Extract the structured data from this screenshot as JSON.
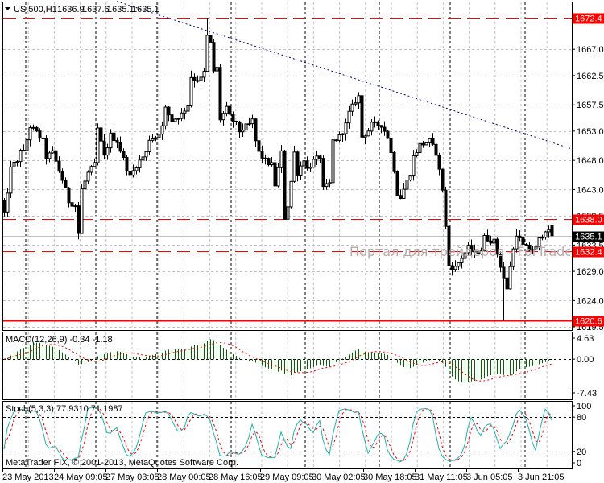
{
  "header": {
    "menu_icon": "triangle-down-icon",
    "symbol": "US.500,H1",
    "open": "1636.9",
    "high": "1637.6",
    "low": "1635.1",
    "close": "1635.1"
  },
  "watermark": "Портал для трейдеров - ForTrader",
  "copyright": "MetaTrader FIX, © 2001-2013, MetaQuotes Software Corp.",
  "price_axis": {
    "labels": [
      "1667.0",
      "1662.5",
      "1657.5",
      "1653.0",
      "1648.0",
      "1643.0",
      "1638.5",
      "1633.5",
      "1629.0",
      "1624.0",
      "1619.5"
    ],
    "range": [
      1619.5,
      1672.4
    ]
  },
  "levels": [
    {
      "price": "1672.4",
      "style": "dashed",
      "color": "#ff0000"
    },
    {
      "price": "1638.0",
      "style": "dashed",
      "color": "#ff0000"
    },
    {
      "price": "1632.4",
      "style": "dashed",
      "color": "#ff0000"
    },
    {
      "price": "1620.6",
      "style": "solid",
      "color": "#ff0000"
    }
  ],
  "current_price": {
    "price": "1635.1",
    "color": "#000000"
  },
  "trendline": {
    "color": "#000080",
    "from": {
      "bar": 35,
      "price": 1675.2
    },
    "to": {
      "bar": 176,
      "price": 1650.0
    }
  },
  "time_axis": [
    "23 May 2013",
    "24 May 09:05",
    "27 May 03:05",
    "28 May 00:05",
    "28 May 16:05",
    "29 May 09:05",
    "30 May 02:05",
    "30 May 18:05",
    "31 May 11:05",
    "3 Jun 05:05",
    "3 Jun 21:05"
  ],
  "macd": {
    "label": "MACD(12,26,9) -0.34 -1.18",
    "axis_labels": [
      "4.63",
      "0.00",
      "-7.43"
    ],
    "range": [
      -7.43,
      4.63
    ],
    "hist_color": "#006400",
    "signal_color": "#ff0000"
  },
  "stoch": {
    "label": "Stoch(5,3,3) 77.9310 71.1987",
    "axis_labels": [
      "100",
      "80",
      "20",
      "0"
    ],
    "main_color": "#20b2aa",
    "signal_color": "#ff0000"
  },
  "chart_data": {
    "type": "candlestick",
    "title": "US.500,H1",
    "ylim": [
      1619.5,
      1672.4
    ],
    "bars": 171,
    "close_path": [
      [
        0,
        1639
      ],
      [
        1,
        1641.9
      ],
      [
        2,
        1647.2
      ],
      [
        4,
        1647.5
      ],
      [
        5,
        1650
      ],
      [
        6,
        1649.3
      ],
      [
        8,
        1653.8
      ],
      [
        10,
        1652.7
      ],
      [
        12,
        1651.3
      ],
      [
        13,
        1648.6
      ],
      [
        15,
        1649.3
      ],
      [
        18,
        1644.7
      ],
      [
        20,
        1641
      ],
      [
        22,
        1640.3
      ],
      [
        23,
        1635.5
      ],
      [
        24,
        1643
      ],
      [
        26,
        1645.8
      ],
      [
        28,
        1647.2
      ],
      [
        29,
        1653.4
      ],
      [
        31,
        1648.6
      ],
      [
        33,
        1652.3
      ],
      [
        35,
        1651.3
      ],
      [
        39,
        1645.1
      ],
      [
        41,
        1647.2
      ],
      [
        44,
        1649.3
      ],
      [
        45,
        1651.7
      ],
      [
        47,
        1652
      ],
      [
        49,
        1653.7
      ],
      [
        50,
        1656.8
      ],
      [
        52,
        1654.8
      ],
      [
        55,
        1655.9
      ],
      [
        57,
        1657.5
      ],
      [
        58,
        1662.3
      ],
      [
        59,
        1661.9
      ],
      [
        61,
        1661.9
      ],
      [
        62,
        1663
      ],
      [
        63,
        1669.2
      ],
      [
        64,
        1667.9
      ],
      [
        65,
        1663.3
      ],
      [
        66,
        1663.7
      ],
      [
        67,
        1655.1
      ],
      [
        69,
        1656.8
      ],
      [
        70,
        1655.5
      ],
      [
        72,
        1654.1
      ],
      [
        73,
        1653
      ],
      [
        76,
        1654.1
      ],
      [
        77,
        1654.8
      ],
      [
        78,
        1651.3
      ],
      [
        79,
        1649.3
      ],
      [
        81,
        1647.9
      ],
      [
        83,
        1647.2
      ],
      [
        84,
        1643.8
      ],
      [
        86,
        1649.3
      ],
      [
        87,
        1638.2
      ],
      [
        88,
        1640.3
      ],
      [
        89,
        1644.4
      ],
      [
        90,
        1649.3
      ],
      [
        91,
        1645.8
      ],
      [
        93,
        1648.3
      ],
      [
        94,
        1646.5
      ],
      [
        96,
        1647.9
      ],
      [
        98,
        1648.6
      ],
      [
        99,
        1643.1
      ],
      [
        101,
        1644
      ],
      [
        102,
        1651.3
      ],
      [
        104,
        1652
      ],
      [
        106,
        1654.1
      ],
      [
        107,
        1656.1
      ],
      [
        109,
        1658.2
      ],
      [
        110,
        1658.9
      ],
      [
        111,
        1652
      ],
      [
        113,
        1653.1
      ],
      [
        114,
        1654.1
      ],
      [
        117,
        1654.1
      ],
      [
        119,
        1652
      ],
      [
        121,
        1646.5
      ],
      [
        122,
        1642.4
      ],
      [
        123,
        1641.7
      ],
      [
        126,
        1645.8
      ],
      [
        127,
        1648.6
      ],
      [
        129,
        1650.6
      ],
      [
        132,
        1651.3
      ],
      [
        134,
        1649.3
      ],
      [
        136,
        1643.1
      ],
      [
        138,
        1630
      ],
      [
        140,
        1629.6
      ],
      [
        142,
        1631.4
      ],
      [
        144,
        1633
      ],
      [
        146,
        1632
      ],
      [
        148,
        1632.7
      ],
      [
        149,
        1634.8
      ],
      [
        152,
        1634.1
      ],
      [
        154,
        1630
      ],
      [
        156,
        1625.8
      ],
      [
        157,
        1630
      ],
      [
        159,
        1635.5
      ],
      [
        161,
        1633.4
      ],
      [
        163,
        1632.7
      ],
      [
        165,
        1633
      ],
      [
        166,
        1634.4
      ],
      [
        168,
        1636.2
      ],
      [
        170,
        1635.1
      ]
    ],
    "extremes": {
      "high_bar": 63,
      "high": 1672.4,
      "low_bar": 155,
      "low": 1620.6
    },
    "last_bar": {
      "open": 1636.9,
      "high": 1637.6,
      "low": 1635.1,
      "close": 1635.1
    }
  }
}
